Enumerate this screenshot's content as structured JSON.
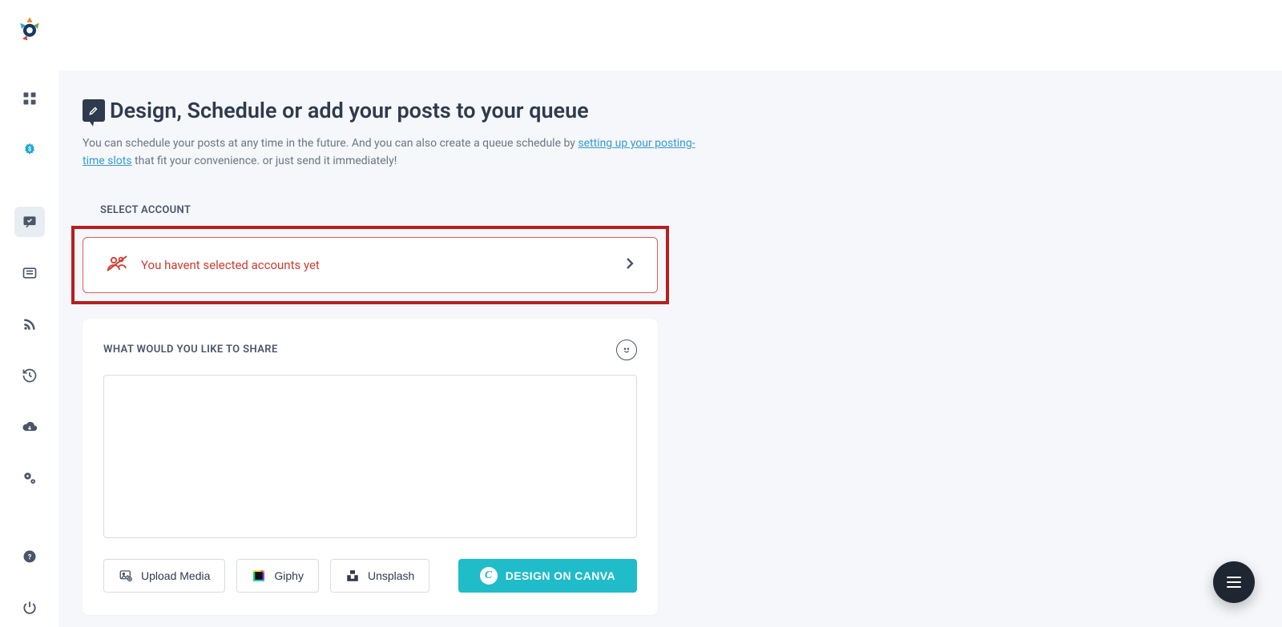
{
  "page": {
    "title": "Design, Schedule or add your posts to your queue",
    "subtitle_before": "You can schedule your posts at any time in the future. And you can also create a queue schedule by ",
    "subtitle_link": "setting up your posting-time slots",
    "subtitle_after": " that fit your convenience. or just send it immediately!"
  },
  "account": {
    "section_label": "SELECT ACCOUNT",
    "empty_text": "You havent selected accounts yet"
  },
  "composer": {
    "label": "WHAT WOULD YOU LIKE TO SHARE",
    "value": "",
    "upload_label": "Upload Media",
    "giphy_label": "Giphy",
    "unsplash_label": "Unsplash",
    "canva_label": "DESIGN ON CANVA"
  },
  "sidebar": {
    "items": [
      {
        "name": "dashboard"
      },
      {
        "name": "monetize"
      },
      {
        "name": "compose"
      },
      {
        "name": "feed"
      },
      {
        "name": "rss"
      },
      {
        "name": "history"
      },
      {
        "name": "cloud"
      },
      {
        "name": "settings"
      }
    ],
    "bottom": [
      {
        "name": "help"
      },
      {
        "name": "power"
      }
    ]
  }
}
